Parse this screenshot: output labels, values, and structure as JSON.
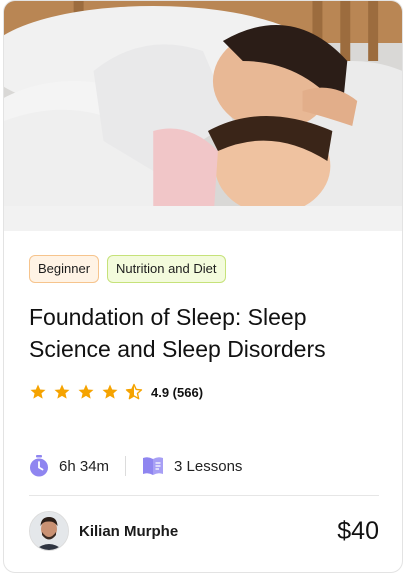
{
  "hero_image": {
    "description_icon": "sleeping-mother-and-child-photo"
  },
  "tags": {
    "level": "Beginner",
    "category": "Nutrition and Diet"
  },
  "course": {
    "title": "Foundation of Sleep: Sleep Science and Sleep Disorders",
    "rating_text": "4.9 (566)",
    "rating_value": 4.5,
    "rating_max": 5,
    "duration": "6h 34m",
    "lessons": "3 Lessons",
    "price": "$40"
  },
  "instructor": {
    "name": "Kilian Murphe",
    "avatar_icon": "avatar-photo"
  },
  "icons": {
    "star": "star-icon",
    "timer": "stopwatch-icon",
    "lessons": "book-icon"
  },
  "colors": {
    "star": "#f5a300",
    "icon_purple": "#8f85f0",
    "level_bg": "#fff3e5",
    "level_border": "#f6c48d",
    "category_bg": "#f3fbdc",
    "category_border": "#c6e27a"
  }
}
